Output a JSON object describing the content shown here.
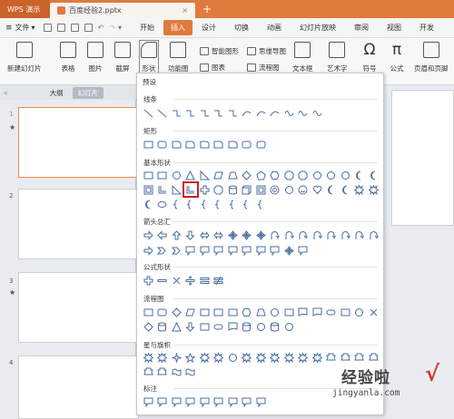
{
  "titlebar": {
    "app_tab": "WPS 演示",
    "doc_tab": "百度经验2.pptx",
    "doc_close": "×",
    "new_tab": "+"
  },
  "menubar": {
    "file": "文件",
    "items": [
      "开始",
      "插入",
      "设计",
      "切换",
      "动画",
      "幻灯片放映",
      "审阅",
      "视图",
      "开发"
    ],
    "active": "插入"
  },
  "ribbon": {
    "new_slide": "新建幻灯片",
    "table": "表格",
    "picture": "图片",
    "screenshot": "截屏",
    "shapes": "形状",
    "function_chart": "功能图",
    "smart_art": "智能图形",
    "chart": "图表",
    "mind_map": "思维导图",
    "flowchart": "流程图",
    "textbox": "文本框",
    "art_text": "艺术字",
    "symbol": "符号",
    "formula": "公式",
    "header_footer": "页眉和页脚"
  },
  "left_panel": {
    "tabs": [
      "大纲",
      "幻灯片"
    ],
    "active_tab": "幻灯片",
    "slides": [
      "1",
      "2",
      "3",
      "4"
    ],
    "star": "★"
  },
  "shapes_menu": {
    "preset": "预设",
    "sections": [
      "线条",
      "矩形",
      "基本形状",
      "箭头总汇",
      "公式形状",
      "流程图",
      "星与旗帜",
      "标注"
    ]
  },
  "watermark": {
    "text": "经验啦",
    "check": "√",
    "url": "jingyanla.com"
  },
  "colors": {
    "accent": "#e07a3d",
    "highlight": "#d41c1c",
    "shape_stroke": "#4a6fa0"
  }
}
